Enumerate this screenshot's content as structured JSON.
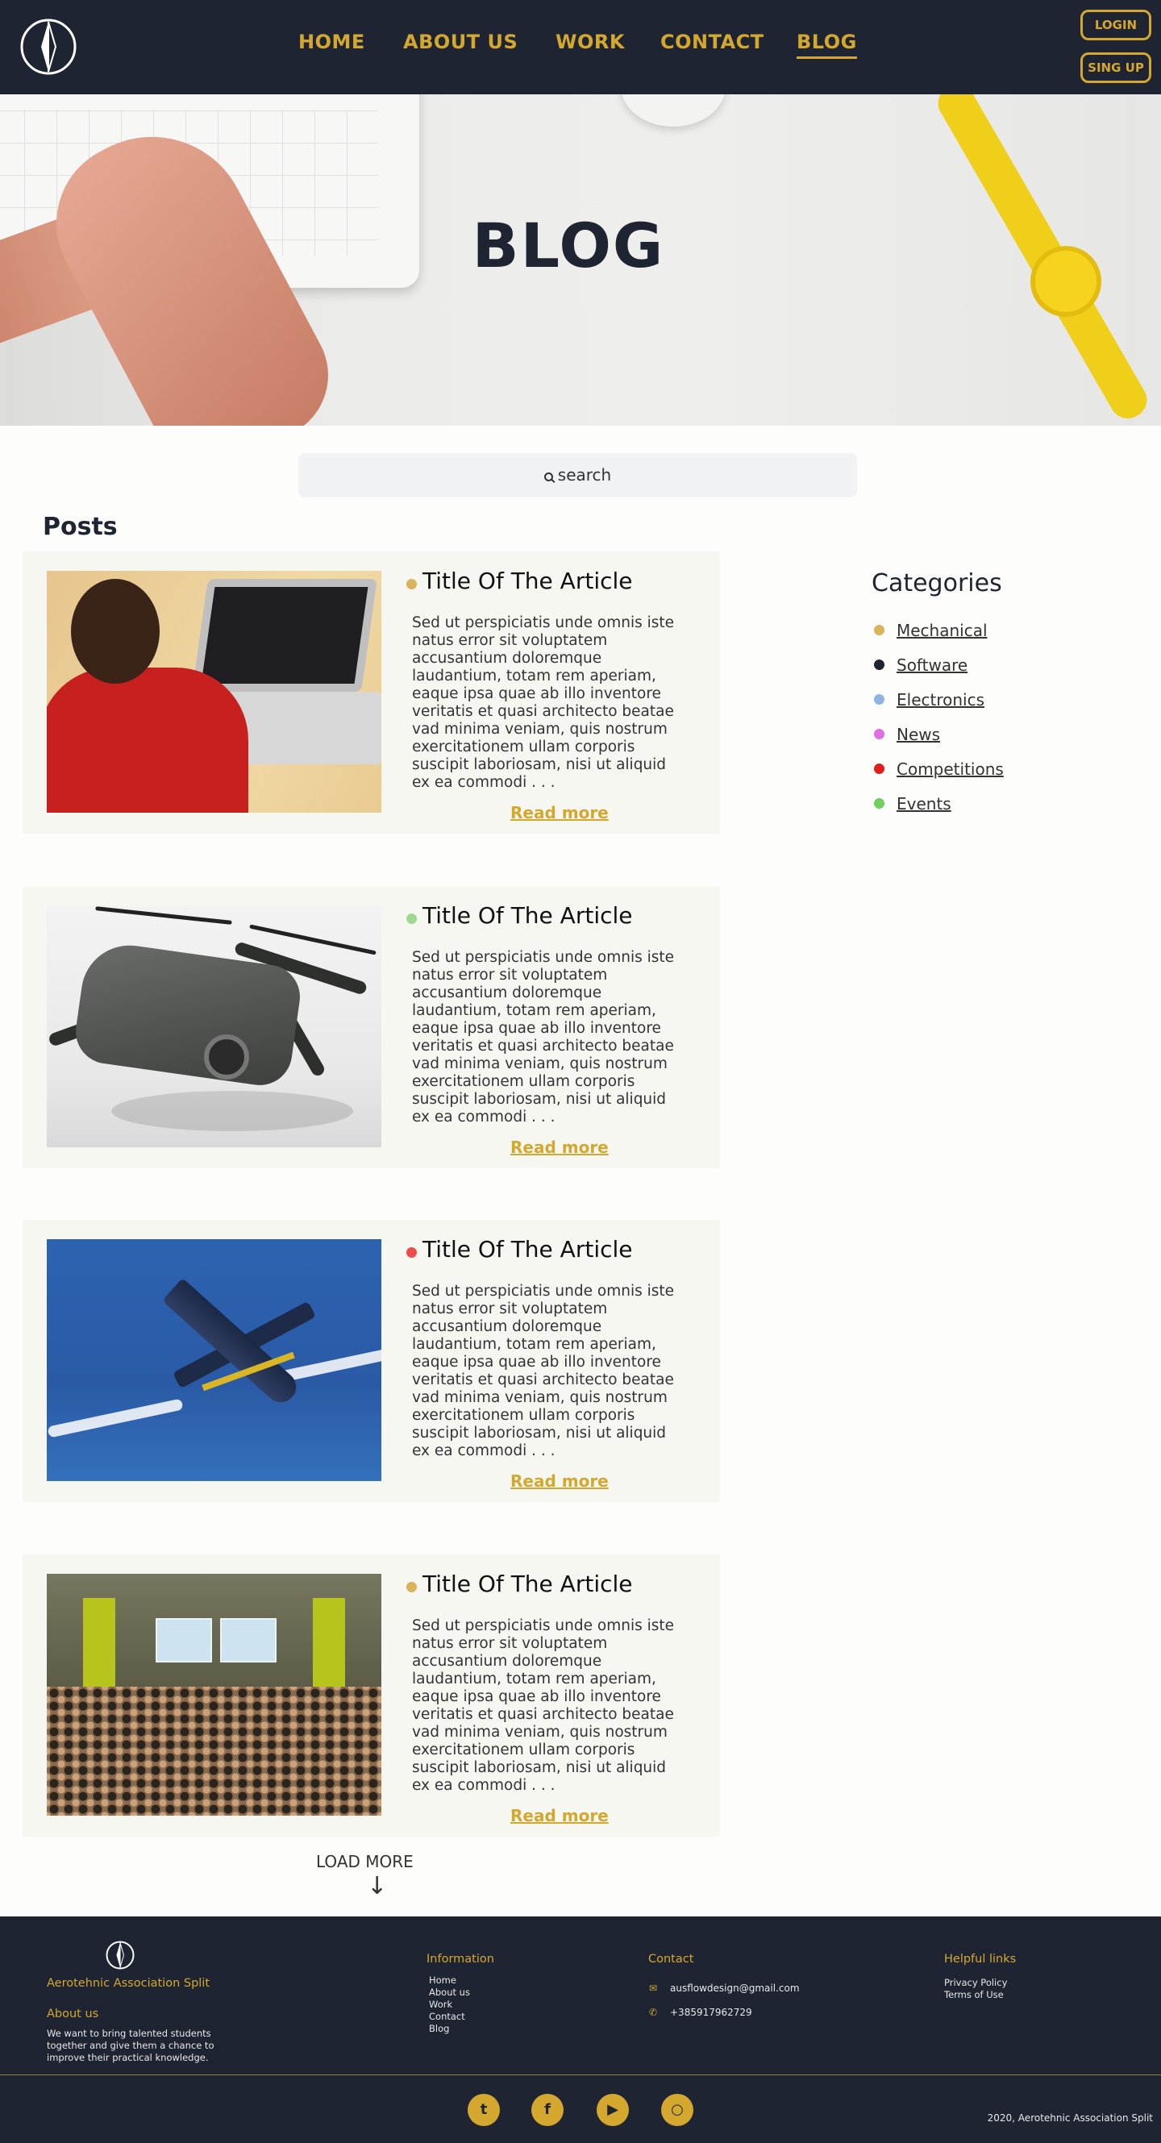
{
  "nav": {
    "home": "HOME",
    "about": "ABOUT US",
    "work": "WORK",
    "contact": "CONTACT",
    "blog": "BLOG",
    "login": "LOGIN",
    "signup": "SING UP"
  },
  "hero": {
    "title": "BLOG"
  },
  "search": {
    "placeholder": "search"
  },
  "posts_title": "Posts",
  "posts": [
    {
      "title": "Title Of The Article",
      "dot_color": "#d9b45a",
      "body": "Sed ut perspiciatis unde omnis iste natus error sit voluptatem accusantium doloremque laudantium, totam rem aperiam, eaque ipsa quae ab illo inventore veritatis et quasi architecto beatae vad minima veniam, quis nostrum exercitationem ullam corporis suscipit laboriosam, nisi ut aliquid ex ea commodi . . .",
      "more": "Read more",
      "image": "person-laptop"
    },
    {
      "title": "Title Of The Article",
      "dot_color": "#9fd88f",
      "body": "Sed ut perspiciatis unde omnis iste natus error sit voluptatem accusantium doloremque laudantium, totam rem aperiam, eaque ipsa quae ab illo inventore veritatis et quasi architecto beatae vad minima veniam, quis nostrum exercitationem ullam corporis suscipit laboriosam, nisi ut aliquid ex ea commodi . . .",
      "more": "Read more",
      "image": "drone"
    },
    {
      "title": "Title Of The Article",
      "dot_color": "#ee4b4b",
      "body": "Sed ut perspiciatis unde omnis iste natus error sit voluptatem accusantium doloremque laudantium, totam rem aperiam, eaque ipsa quae ab illo inventore veritatis et quasi architecto beatae vad minima veniam, quis nostrum exercitationem ullam corporis suscipit laboriosam, nisi ut aliquid ex ea commodi . . .",
      "more": "Read more",
      "image": "jet"
    },
    {
      "title": "Title Of The Article",
      "dot_color": "#d9b45a",
      "body": "Sed ut perspiciatis unde omnis iste natus error sit voluptatem accusantium doloremque laudantium, totam rem aperiam, eaque ipsa quae ab illo inventore veritatis et quasi architecto beatae vad minima veniam, quis nostrum exercitationem ullam corporis suscipit laboriosam, nisi ut aliquid ex ea commodi . . .",
      "more": "Read more",
      "image": "lecture-hall"
    }
  ],
  "categories": {
    "title": "Categories",
    "items": [
      {
        "label": "Mechanical",
        "color": "#d9b45a"
      },
      {
        "label": "Software",
        "color": "#1f2433"
      },
      {
        "label": "Electronics",
        "color": "#8eb4e3"
      },
      {
        "label": "News",
        "color": "#e06fe0"
      },
      {
        "label": "Competitions",
        "color": "#e01e1e"
      },
      {
        "label": "Events",
        "color": "#6fcf5f"
      }
    ]
  },
  "load_more": "LOAD MORE",
  "footer": {
    "brand": "Aerotehnic Association Split",
    "about_title": "About us",
    "about_text": "We want to bring talented students together and give them a chance to improve their practical knowledge.",
    "info_title": "Information",
    "info_links": [
      "Home",
      "About us",
      "Work",
      "Contact",
      "Blog"
    ],
    "contact_title": "Contact",
    "email": "ausflowdesign@gmail.com",
    "phone": "+385917962729",
    "helpful_title": "Helpful links",
    "helpful_links": [
      "Privacy Policy",
      "Terms of Use"
    ],
    "social": [
      "twitter-icon",
      "facebook-icon",
      "youtube-icon",
      "instagram-icon"
    ],
    "copyright": "2020, Aerotehnic Association Split"
  },
  "colors": {
    "accent": "#d4a82e",
    "dark": "#1f2433",
    "card_bg": "#f7f7f2"
  }
}
